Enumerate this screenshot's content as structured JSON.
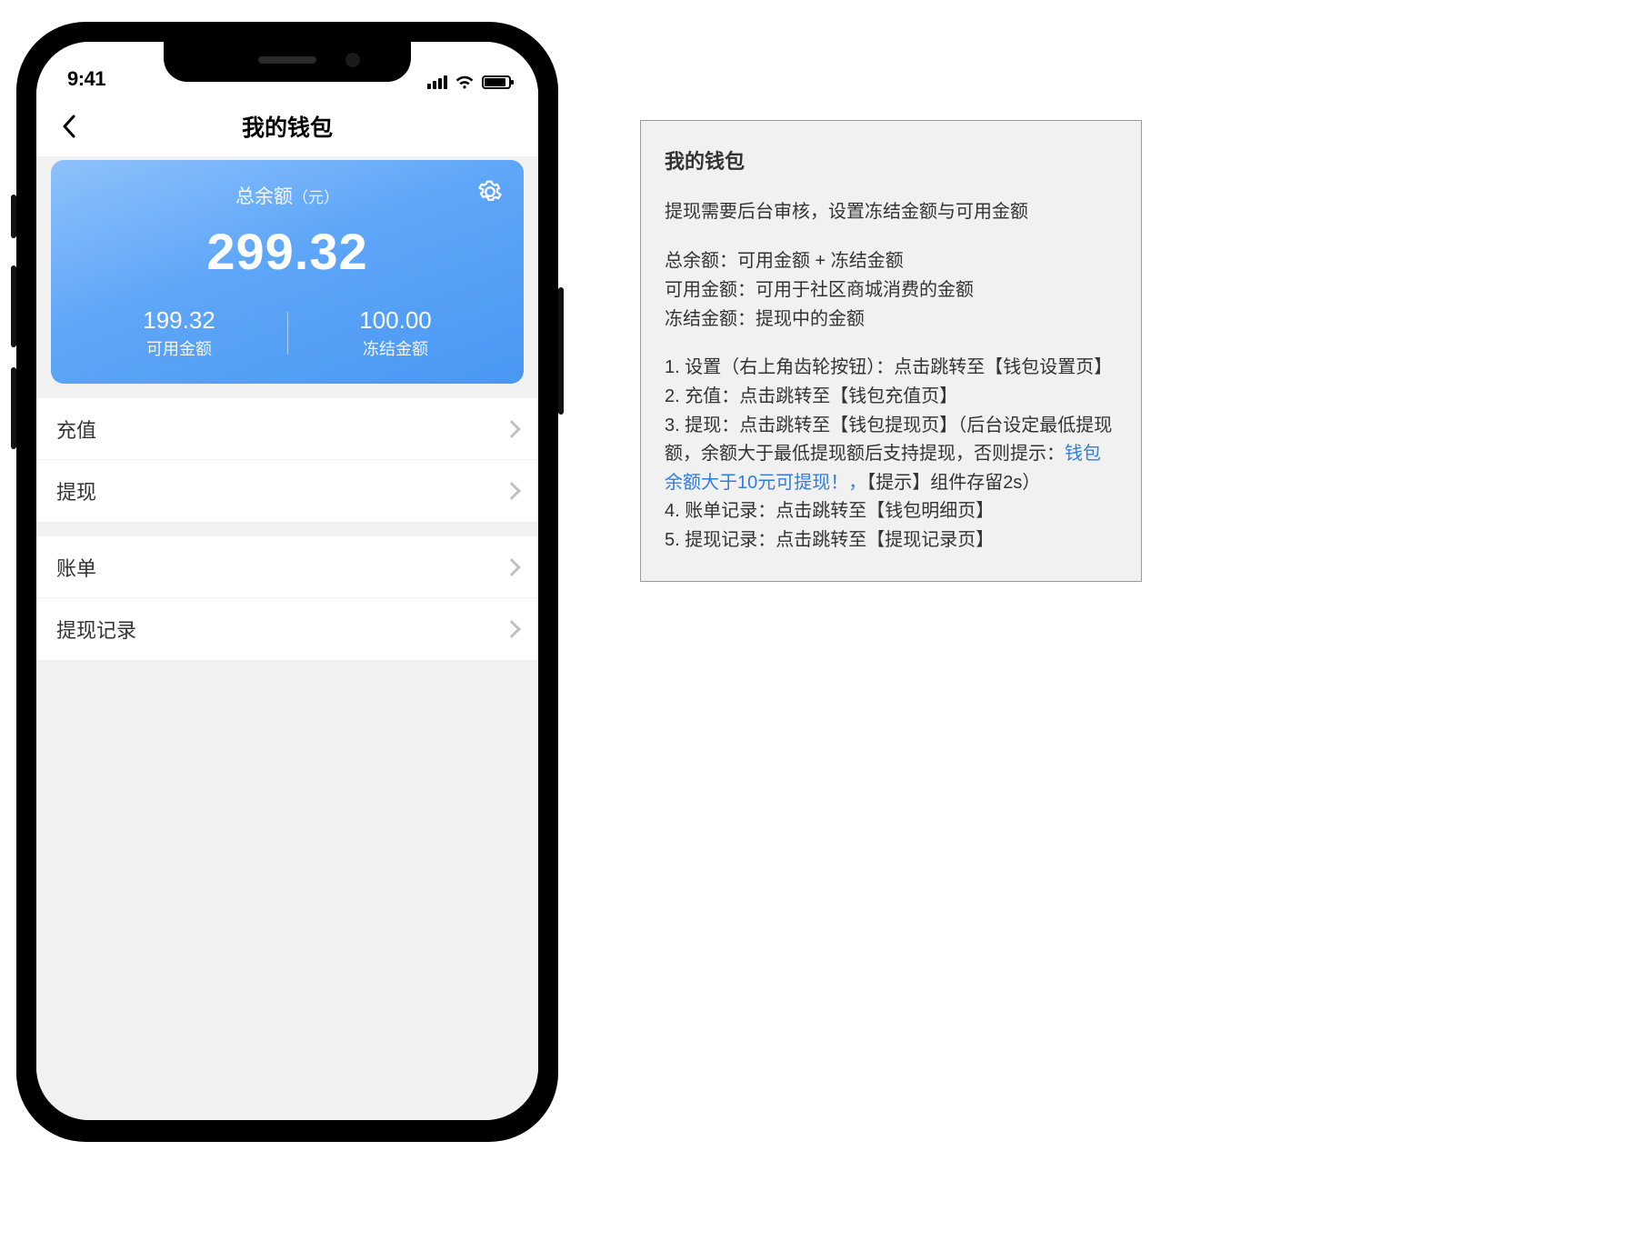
{
  "statusbar": {
    "time": "9:41"
  },
  "navbar": {
    "title": "我的钱包"
  },
  "balance": {
    "label": "总余额",
    "unit": "（元）",
    "amount": "299.32",
    "available_value": "199.32",
    "available_label": "可用金额",
    "frozen_value": "100.00",
    "frozen_label": "冻结金额"
  },
  "menu": {
    "recharge": "充值",
    "withdraw": "提现",
    "bill": "账单",
    "withdraw_records": "提现记录"
  },
  "notes": {
    "title": "我的钱包",
    "subtitle": "提现需要后台审核，设置冻结金额与可用金额",
    "def1": "总余额：可用金额 + 冻结金额",
    "def2": "可用金额：可用于社区商城消费的金额",
    "def3": "冻结金额：提现中的金额",
    "item1": "1. 设置（右上角齿轮按钮）：点击跳转至【钱包设置页】",
    "item2": "2. 充值：点击跳转至【钱包充值页】",
    "item3a": "3. 提现：点击跳转至【钱包提现页】（后台设定最低提现额，余额大于最低提现额后支持提现，否则提示：",
    "item3_link": "钱包余额大于10元可提现！，",
    "item3b": "【提示】组件存留2s）",
    "item4": "4. 账单记录：点击跳转至【钱包明细页】",
    "item5": "5. 提现记录：点击跳转至【提现记录页】"
  }
}
